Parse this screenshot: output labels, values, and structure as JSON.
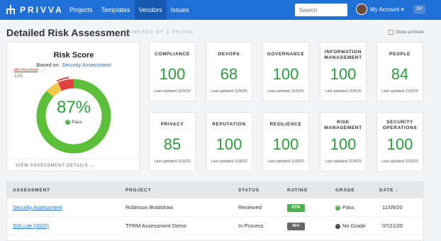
{
  "brand": {
    "name": "PRIVVA",
    "color": "#1f6fd6",
    "icon": "org-chart-icon"
  },
  "nav": {
    "items": [
      {
        "label": "Projects",
        "active": false
      },
      {
        "label": "Templates",
        "active": false
      },
      {
        "label": "Vendors",
        "active": true
      },
      {
        "label": "Issues",
        "active": false
      }
    ],
    "search_placeholder": "Search",
    "account_label": "My Account",
    "badge": "187"
  },
  "header": {
    "title": "Detailed Risk Assessment",
    "powered_by": "POWERED BY",
    "powered_brand": "PRIVVA",
    "show_archived": "Show archived"
  },
  "risk": {
    "title": "Risk Score",
    "based_on": "Based on",
    "assessment_link": "Security Assessment",
    "score": "87%",
    "status": "Pass",
    "threshold_label": "Min threshold",
    "threshold_pct": "12%",
    "footer": "VIEW ASSESSMENT DETAILS →",
    "segments": {
      "pass": 87,
      "warn": 6,
      "fail": 7
    },
    "colors": {
      "pass": "#5cbf3a",
      "warn": "#f2c84b",
      "fail": "#e04040"
    }
  },
  "cards": [
    {
      "title": "COMPLIANCE",
      "value": "100",
      "updated": "Last updated 11/9/20"
    },
    {
      "title": "DEVOPS",
      "value": "68",
      "updated": "Last updated 11/9/20"
    },
    {
      "title": "GOVERNANCE",
      "value": "100",
      "updated": "Last updated 11/9/20"
    },
    {
      "title": "INFORMATION MANAGEMENT",
      "value": "100",
      "updated": "Last updated 11/9/20"
    },
    {
      "title": "PEOPLE",
      "value": "84",
      "updated": "Last updated 11/9/20"
    },
    {
      "title": "PRIVACY",
      "value": "85",
      "updated": "Last updated 11/9/20"
    },
    {
      "title": "REPUTATION",
      "value": "100",
      "updated": "Last updated 11/9/20"
    },
    {
      "title": "RESILIENCE",
      "value": "100",
      "updated": "Last updated 11/9/20"
    },
    {
      "title": "RISK MANAGEMENT",
      "value": "100",
      "updated": "Last updated 11/9/20"
    },
    {
      "title": "SECURITY OPERATIONS",
      "value": "100",
      "updated": "Last updated 11/9/20"
    }
  ],
  "table": {
    "headers": [
      "ASSESSMENT",
      "PROJECT",
      "STATUS",
      "RATING",
      "GRADE",
      "DATE ↓"
    ],
    "rows": [
      {
        "assessment": "Security Assessment",
        "project": "Robinson Bradshaw",
        "status": "Reviewed",
        "rating": "87%",
        "rating_color": "#4caf50",
        "grade": "Pass",
        "grade_icon": "check-circle-icon",
        "date": "11/09/20"
      },
      {
        "assessment": "SIG Lite (2020)",
        "project": "TPRM Assessment Demo",
        "status": "In Process",
        "rating": "N/A",
        "rating_color": "#666666",
        "grade": "No Grade",
        "grade_icon": "minus-circle-icon",
        "date": "07/21/20"
      }
    ]
  }
}
